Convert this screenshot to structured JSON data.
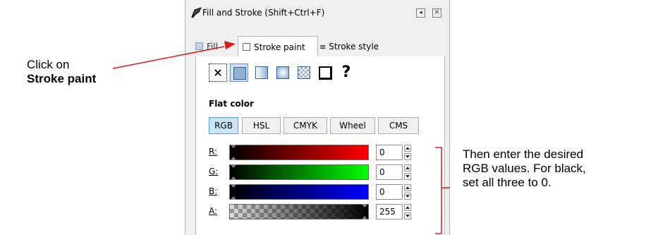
{
  "dialog": {
    "title": "Fill and Stroke (Shift+Ctrl+F)",
    "tabs": [
      "Fill",
      "Stroke paint",
      "Stroke style"
    ],
    "paint_buttons": [
      "none-paint-icon",
      "flat-color-icon",
      "linear-gradient-icon",
      "radial-gradient-icon",
      "pattern-icon",
      "swatch-icon",
      "unset-paint-icon"
    ],
    "paint_none_glyph": "×",
    "paint_unset_glyph": "?",
    "section_label": "Flat color",
    "modes": [
      "RGB",
      "HSL",
      "CMYK",
      "Wheel",
      "CMS"
    ],
    "channels": [
      {
        "label": "R:",
        "value": "0"
      },
      {
        "label": "G:",
        "value": "0"
      },
      {
        "label": "B:",
        "value": "0"
      },
      {
        "label": "A:",
        "value": "255"
      }
    ]
  },
  "annotations": {
    "left_line1": "Click on",
    "left_line2": "Stroke paint",
    "right_line1": "Then enter the desired",
    "right_line2": "RGB values. For black,",
    "right_line3": "set all three to 0."
  },
  "colors": {
    "annotation": "#e01b1b",
    "active_mode": "#cce4f7"
  }
}
